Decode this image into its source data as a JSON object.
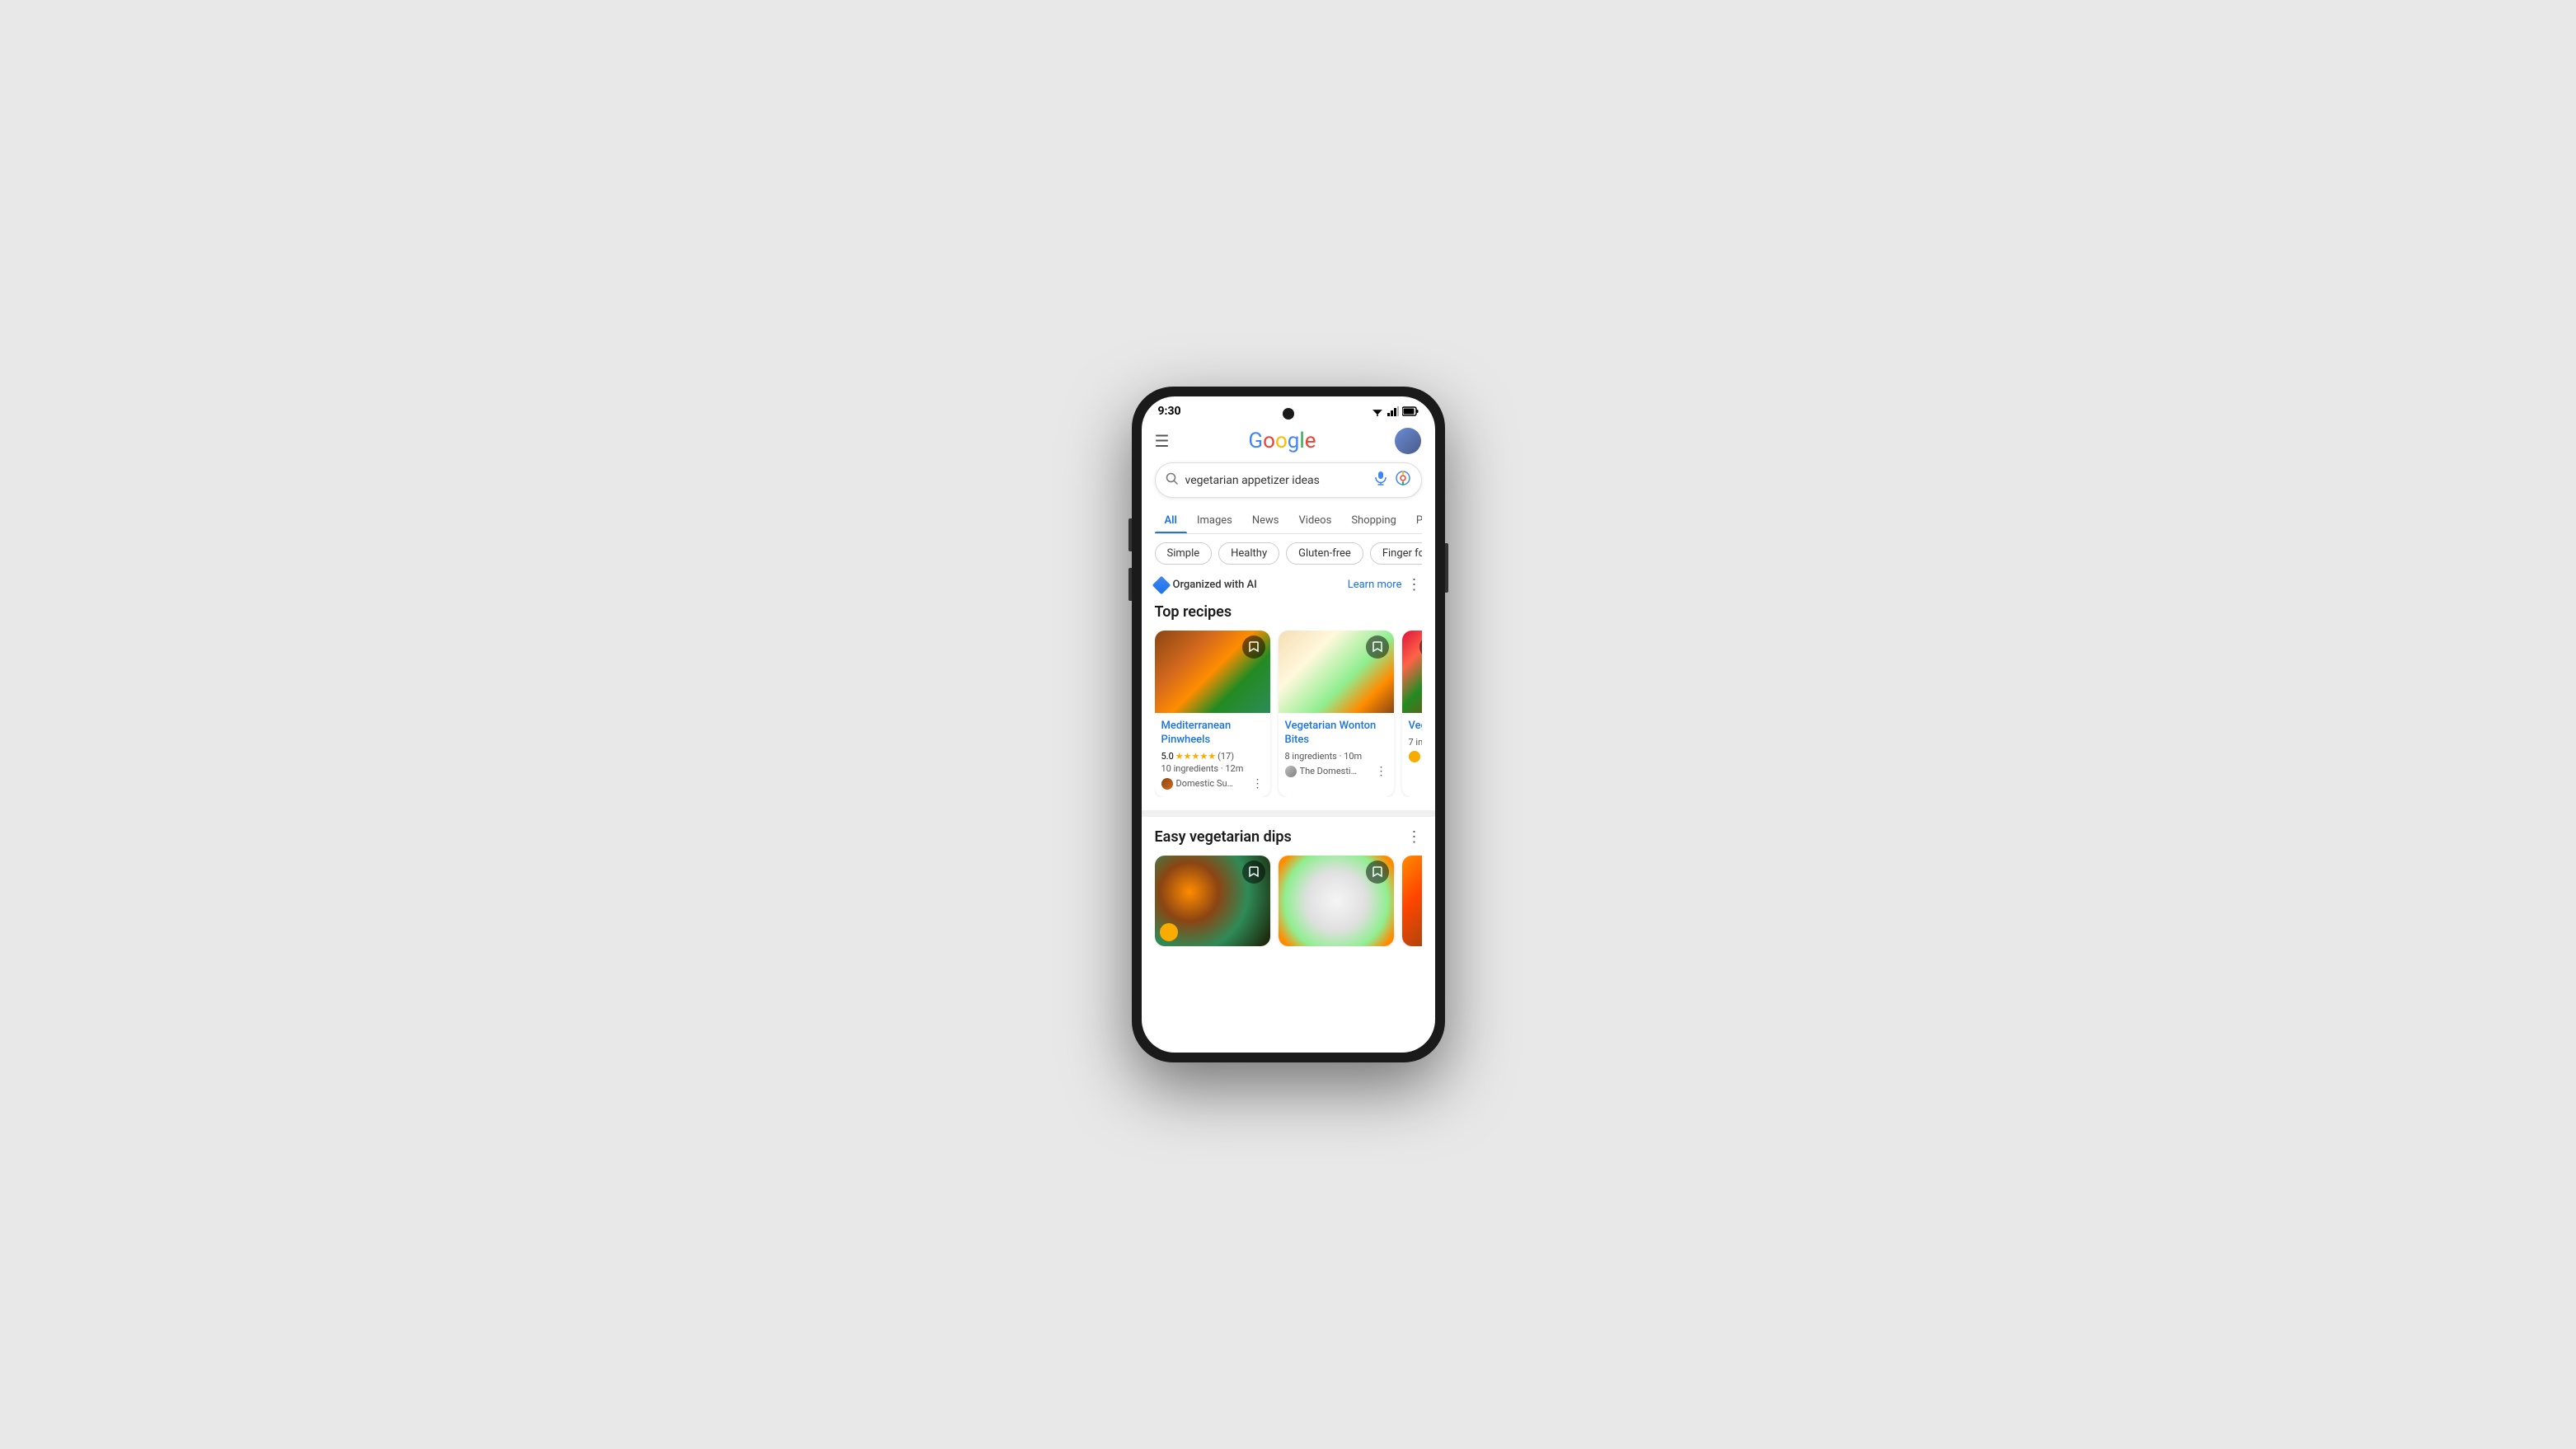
{
  "phone": {
    "time": "9:30",
    "camera_label": "front-camera"
  },
  "search": {
    "query": "vegetarian appetizer ideas",
    "voice_label": "Voice search",
    "lens_label": "Search by image",
    "placeholder": "Search"
  },
  "tabs": [
    {
      "id": "all",
      "label": "All",
      "active": true
    },
    {
      "id": "images",
      "label": "Images",
      "active": false
    },
    {
      "id": "news",
      "label": "News",
      "active": false
    },
    {
      "id": "videos",
      "label": "Videos",
      "active": false
    },
    {
      "id": "shopping",
      "label": "Shopping",
      "active": false
    },
    {
      "id": "personal",
      "label": "Pers…",
      "active": false
    }
  ],
  "filter_chips": [
    {
      "id": "simple",
      "label": "Simple"
    },
    {
      "id": "healthy",
      "label": "Healthy"
    },
    {
      "id": "gluten-free",
      "label": "Gluten-free"
    },
    {
      "id": "finger-food",
      "label": "Finger foo…"
    }
  ],
  "ai_section": {
    "label": "Organized with AI",
    "learn_more": "Learn more",
    "more_options": "More options"
  },
  "top_recipes": {
    "title": "Top recipes",
    "cards": [
      {
        "id": "card1",
        "title": "Mediterranean Pinwheels",
        "rating": "5.0",
        "rating_count": "(17)",
        "ingredients": "10 ingredients",
        "time": "12m",
        "source": "Domestic Su…",
        "img_class": "food-img-1"
      },
      {
        "id": "card2",
        "title": "Vegetarian Wonton Bites",
        "rating": null,
        "rating_count": null,
        "ingredients": "8 ingredients",
        "time": "10m",
        "source": "The Domesti…",
        "img_class": "food-img-2"
      },
      {
        "id": "card3",
        "title": "Veg…",
        "rating": null,
        "rating_count": null,
        "ingredients": "7 in…",
        "time": null,
        "source": null,
        "img_class": "food-img-3",
        "partial": true
      }
    ]
  },
  "easy_dips": {
    "title": "Easy vegetarian dips",
    "cards": [
      {
        "id": "dip1",
        "img_class": "food-img-dip1"
      },
      {
        "id": "dip2",
        "img_class": "food-img-dip2"
      },
      {
        "id": "dip3",
        "img_class": "food-img-dip3",
        "partial": true
      }
    ]
  },
  "icons": {
    "menu": "☰",
    "bookmark": "🔖",
    "voice": "🎤",
    "more_vert": "⋮",
    "search": "🔍"
  }
}
